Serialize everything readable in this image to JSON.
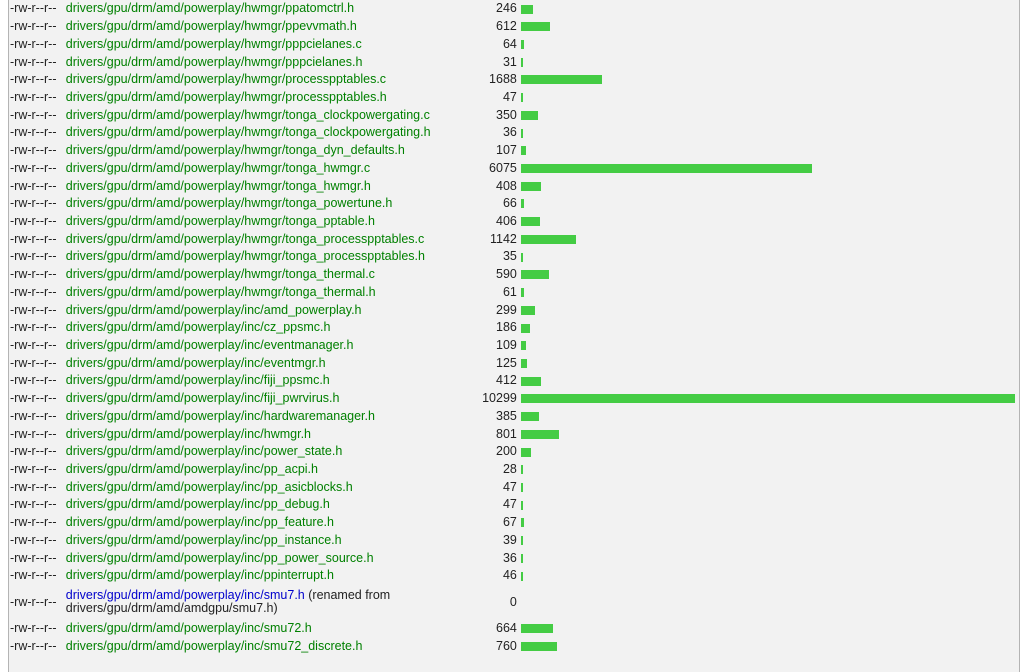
{
  "max_changes": 10299,
  "rows": [
    {
      "mode": "-rw-r--r--",
      "path": "drivers/gpu/drm/amd/powerplay/hwmgr/ppatomctrl.h",
      "changes": 246
    },
    {
      "mode": "-rw-r--r--",
      "path": "drivers/gpu/drm/amd/powerplay/hwmgr/ppevvmath.h",
      "changes": 612
    },
    {
      "mode": "-rw-r--r--",
      "path": "drivers/gpu/drm/amd/powerplay/hwmgr/pppcielanes.c",
      "changes": 64
    },
    {
      "mode": "-rw-r--r--",
      "path": "drivers/gpu/drm/amd/powerplay/hwmgr/pppcielanes.h",
      "changes": 31
    },
    {
      "mode": "-rw-r--r--",
      "path": "drivers/gpu/drm/amd/powerplay/hwmgr/processpptables.c",
      "changes": 1688
    },
    {
      "mode": "-rw-r--r--",
      "path": "drivers/gpu/drm/amd/powerplay/hwmgr/processpptables.h",
      "changes": 47
    },
    {
      "mode": "-rw-r--r--",
      "path": "drivers/gpu/drm/amd/powerplay/hwmgr/tonga_clockpowergating.c",
      "changes": 350
    },
    {
      "mode": "-rw-r--r--",
      "path": "drivers/gpu/drm/amd/powerplay/hwmgr/tonga_clockpowergating.h",
      "changes": 36
    },
    {
      "mode": "-rw-r--r--",
      "path": "drivers/gpu/drm/amd/powerplay/hwmgr/tonga_dyn_defaults.h",
      "changes": 107
    },
    {
      "mode": "-rw-r--r--",
      "path": "drivers/gpu/drm/amd/powerplay/hwmgr/tonga_hwmgr.c",
      "changes": 6075
    },
    {
      "mode": "-rw-r--r--",
      "path": "drivers/gpu/drm/amd/powerplay/hwmgr/tonga_hwmgr.h",
      "changes": 408
    },
    {
      "mode": "-rw-r--r--",
      "path": "drivers/gpu/drm/amd/powerplay/hwmgr/tonga_powertune.h",
      "changes": 66
    },
    {
      "mode": "-rw-r--r--",
      "path": "drivers/gpu/drm/amd/powerplay/hwmgr/tonga_pptable.h",
      "changes": 406
    },
    {
      "mode": "-rw-r--r--",
      "path": "drivers/gpu/drm/amd/powerplay/hwmgr/tonga_processpptables.c",
      "changes": 1142
    },
    {
      "mode": "-rw-r--r--",
      "path": "drivers/gpu/drm/amd/powerplay/hwmgr/tonga_processpptables.h",
      "changes": 35
    },
    {
      "mode": "-rw-r--r--",
      "path": "drivers/gpu/drm/amd/powerplay/hwmgr/tonga_thermal.c",
      "changes": 590
    },
    {
      "mode": "-rw-r--r--",
      "path": "drivers/gpu/drm/amd/powerplay/hwmgr/tonga_thermal.h",
      "changes": 61
    },
    {
      "mode": "-rw-r--r--",
      "path": "drivers/gpu/drm/amd/powerplay/inc/amd_powerplay.h",
      "changes": 299
    },
    {
      "mode": "-rw-r--r--",
      "path": "drivers/gpu/drm/amd/powerplay/inc/cz_ppsmc.h",
      "changes": 186
    },
    {
      "mode": "-rw-r--r--",
      "path": "drivers/gpu/drm/amd/powerplay/inc/eventmanager.h",
      "changes": 109
    },
    {
      "mode": "-rw-r--r--",
      "path": "drivers/gpu/drm/amd/powerplay/inc/eventmgr.h",
      "changes": 125
    },
    {
      "mode": "-rw-r--r--",
      "path": "drivers/gpu/drm/amd/powerplay/inc/fiji_ppsmc.h",
      "changes": 412
    },
    {
      "mode": "-rw-r--r--",
      "path": "drivers/gpu/drm/amd/powerplay/inc/fiji_pwrvirus.h",
      "changes": 10299
    },
    {
      "mode": "-rw-r--r--",
      "path": "drivers/gpu/drm/amd/powerplay/inc/hardwaremanager.h",
      "changes": 385
    },
    {
      "mode": "-rw-r--r--",
      "path": "drivers/gpu/drm/amd/powerplay/inc/hwmgr.h",
      "changes": 801
    },
    {
      "mode": "-rw-r--r--",
      "path": "drivers/gpu/drm/amd/powerplay/inc/power_state.h",
      "changes": 200
    },
    {
      "mode": "-rw-r--r--",
      "path": "drivers/gpu/drm/amd/powerplay/inc/pp_acpi.h",
      "changes": 28
    },
    {
      "mode": "-rw-r--r--",
      "path": "drivers/gpu/drm/amd/powerplay/inc/pp_asicblocks.h",
      "changes": 47
    },
    {
      "mode": "-rw-r--r--",
      "path": "drivers/gpu/drm/amd/powerplay/inc/pp_debug.h",
      "changes": 47
    },
    {
      "mode": "-rw-r--r--",
      "path": "drivers/gpu/drm/amd/powerplay/inc/pp_feature.h",
      "changes": 67
    },
    {
      "mode": "-rw-r--r--",
      "path": "drivers/gpu/drm/amd/powerplay/inc/pp_instance.h",
      "changes": 39
    },
    {
      "mode": "-rw-r--r--",
      "path": "drivers/gpu/drm/amd/powerplay/inc/pp_power_source.h",
      "changes": 36
    },
    {
      "mode": "-rw-r--r--",
      "path": "drivers/gpu/drm/amd/powerplay/inc/ppinterrupt.h",
      "changes": 46
    },
    {
      "mode": "-rw-r--r--",
      "path": "drivers/gpu/drm/amd/powerplay/inc/smu7.h",
      "changes": 0,
      "renamed": true,
      "note": " (renamed from drivers/gpu/drm/amd/amdgpu/smu7.h)"
    },
    {
      "mode": "-rw-r--r--",
      "path": "drivers/gpu/drm/amd/powerplay/inc/smu72.h",
      "changes": 664
    },
    {
      "mode": "-rw-r--r--",
      "path": "drivers/gpu/drm/amd/powerplay/inc/smu72_discrete.h",
      "changes": 760
    }
  ],
  "colors": {
    "added_bar": "#44cc44",
    "path_link": "#008000",
    "renamed_link": "#0000cc"
  }
}
